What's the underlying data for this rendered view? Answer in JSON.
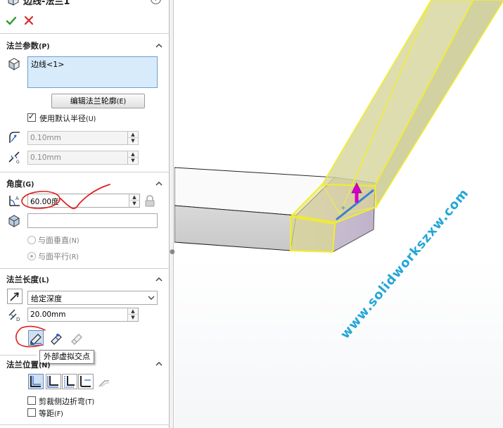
{
  "panel": {
    "title": "边线-法兰1",
    "help_glyph": "?"
  },
  "flange_params": {
    "title": "法兰参数",
    "hotkey": "(P)",
    "edge_item": "边线<1>",
    "edit_profile_label": "编辑法兰轮廓",
    "edit_profile_hotkey": "(E)",
    "default_radius_label": "使用默认半径",
    "default_radius_hotkey": "(U)",
    "default_radius_checked": true,
    "radius_value": "0.10mm",
    "gap_value": "0.10mm"
  },
  "angle": {
    "title": "角度",
    "hotkey": "(G)",
    "value": "60.00度",
    "normal_label": "与面垂直",
    "normal_hotkey": "(N)",
    "parallel_label": "与面平行",
    "parallel_hotkey": "(R)",
    "selected_option": "parallel"
  },
  "flange_length": {
    "title": "法兰长度",
    "hotkey": "(L)",
    "end_condition": "给定深度",
    "length_value": "20.00mm",
    "tooltip": "外部虚拟交点"
  },
  "flange_position": {
    "title": "法兰位置",
    "hotkey": "(N)",
    "trim_side_label": "剪裁侧边折弯",
    "trim_side_hotkey": "(T)",
    "trim_side_checked": false,
    "offset_label": "等距",
    "offset_hotkey": "(F)",
    "offset_checked": false
  },
  "viewport": {
    "watermark": "www.solidworkszxw.com"
  },
  "colors": {
    "selection_blue": "#d8ebfb",
    "highlight_yellow": "#f2ee2a",
    "preview_fill": "#d6d49b",
    "arrow_magenta": "#d400c8",
    "annotation_red": "#e02020",
    "watermark": "#23a6d6"
  }
}
